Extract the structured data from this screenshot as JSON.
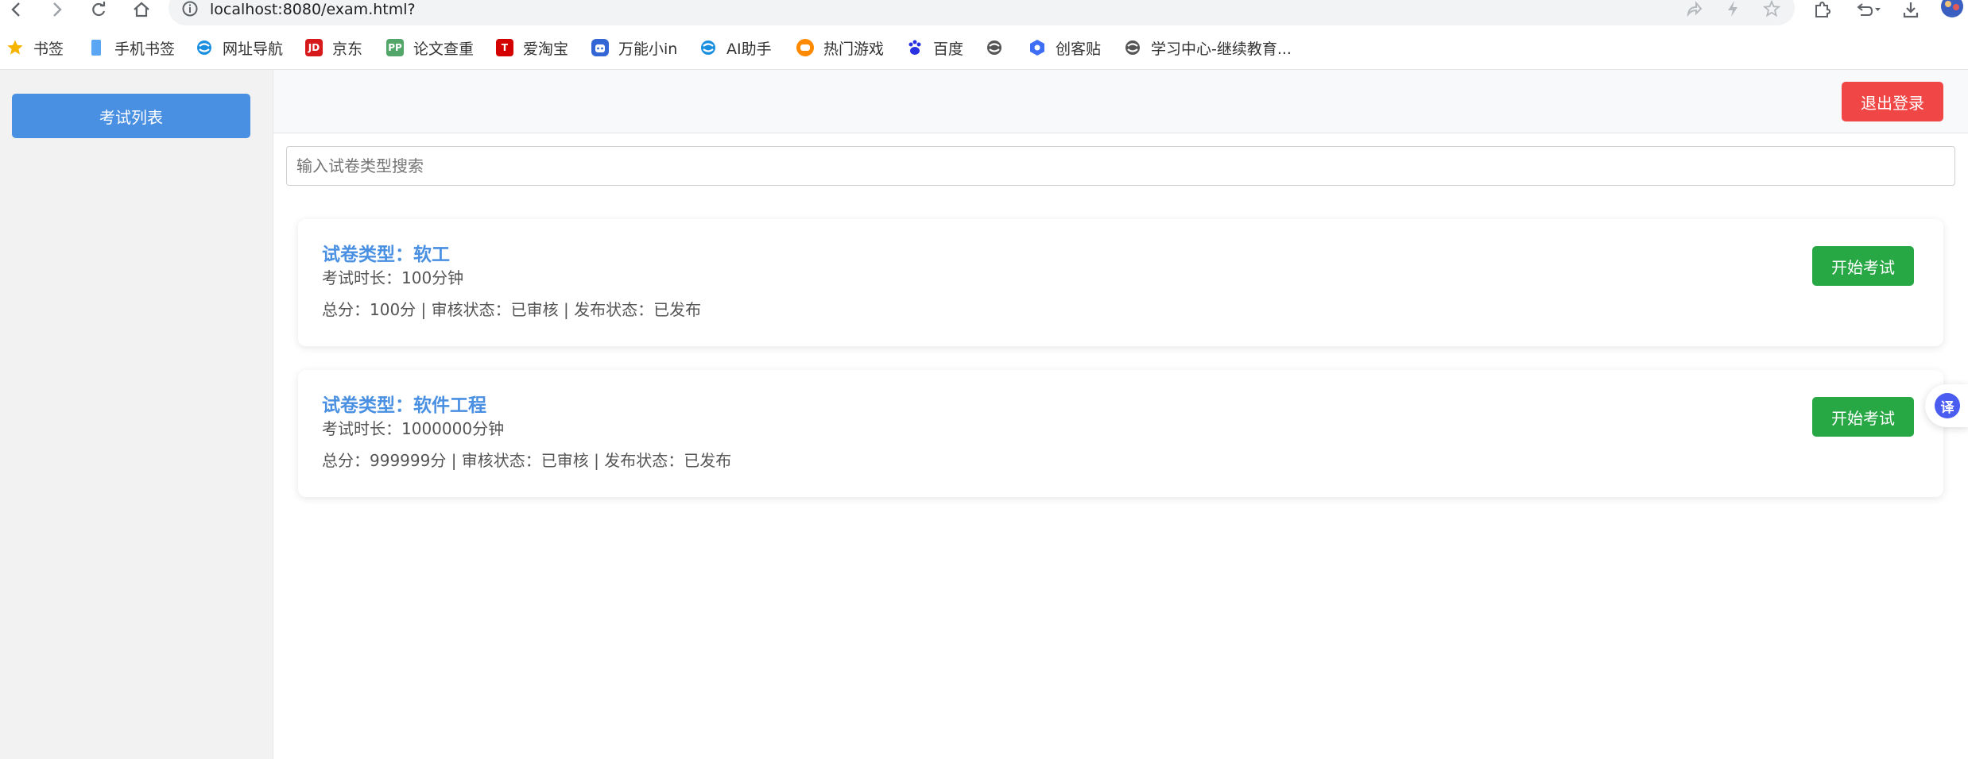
{
  "browser": {
    "url": "localhost:8080/exam.html?",
    "bookmarks": [
      {
        "label": "书签",
        "icon": "star-icon",
        "color": "#f5b400"
      },
      {
        "label": "手机书签",
        "icon": "phone-icon",
        "color": "#5aa6f5"
      },
      {
        "label": "网址导航",
        "icon": "browser-logo-icon",
        "color": "#1a8fe0"
      },
      {
        "label": "京东",
        "icon": "jd-icon",
        "color": "#d7191b"
      },
      {
        "label": "论文查重",
        "icon": "pp-icon",
        "color": "#52a66a"
      },
      {
        "label": "爱淘宝",
        "icon": "taobao-icon",
        "color": "#d40000"
      },
      {
        "label": "万能小in",
        "icon": "robot-icon",
        "color": "#3367d6"
      },
      {
        "label": "AI助手",
        "icon": "ai-assistant-icon",
        "color": "#1a8fe0"
      },
      {
        "label": "热门游戏",
        "icon": "game-icon",
        "color": "#ff8a00"
      },
      {
        "label": "百度",
        "icon": "baidu-paw-icon",
        "color": "#2932e1"
      },
      {
        "label": "",
        "icon": "browser-logo-icon",
        "color": "#555555"
      },
      {
        "label": "创客贴",
        "icon": "chuangketie-icon",
        "color": "#3d6ef5"
      },
      {
        "label": "学习中心-继续教育...",
        "icon": "browser-logo-icon",
        "color": "#555555"
      }
    ]
  },
  "sidebar": {
    "exam_list_label": "考试列表"
  },
  "header": {
    "logout_label": "退出登录"
  },
  "search": {
    "placeholder": "输入试卷类型搜索",
    "value": ""
  },
  "exams": [
    {
      "title": "试卷类型：软工",
      "duration": "考试时长：100分钟",
      "meta": "总分：100分 | 审核状态：已审核 | 发布状态：已发布",
      "button": "开始考试"
    },
    {
      "title": "试卷类型：软件工程",
      "duration": "考试时长：1000000分钟",
      "meta": "总分：999999分 | 审核状态：已审核 | 发布状态：已发布",
      "button": "开始考试"
    }
  ],
  "floating": {
    "translate_glyph": "译"
  },
  "colors": {
    "primary": "#4a90e2",
    "danger": "#f14646",
    "success": "#28a745"
  }
}
